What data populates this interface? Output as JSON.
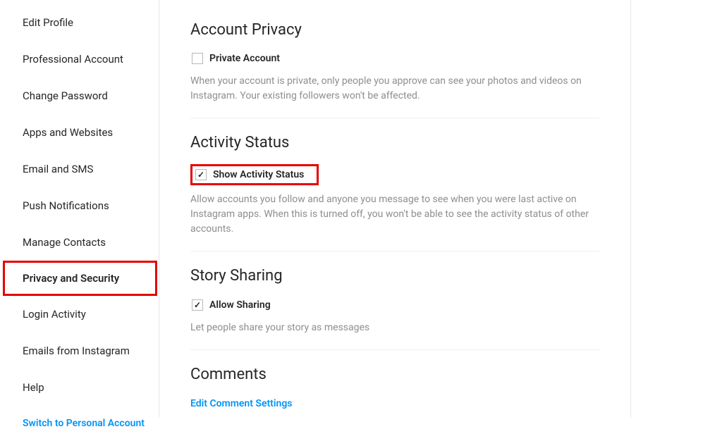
{
  "sidebar": {
    "items": [
      {
        "label": "Edit Profile"
      },
      {
        "label": "Professional Account"
      },
      {
        "label": "Change Password"
      },
      {
        "label": "Apps and Websites"
      },
      {
        "label": "Email and SMS"
      },
      {
        "label": "Push Notifications"
      },
      {
        "label": "Manage Contacts"
      },
      {
        "label": "Privacy and Security"
      },
      {
        "label": "Login Activity"
      },
      {
        "label": "Emails from Instagram"
      },
      {
        "label": "Help"
      }
    ],
    "switch_link": "Switch to Personal Account"
  },
  "sections": {
    "account_privacy": {
      "title": "Account Privacy",
      "checkbox_label": "Private Account",
      "description": "When your account is private, only people you approve can see your photos and videos on Instagram. Your existing followers won't be affected."
    },
    "activity_status": {
      "title": "Activity Status",
      "checkbox_label": "Show Activity Status",
      "description": "Allow accounts you follow and anyone you message to see when you were last active on Instagram apps. When this is turned off, you won't be able to see the activity status of other accounts."
    },
    "story_sharing": {
      "title": "Story Sharing",
      "checkbox_label": "Allow Sharing",
      "description": "Let people share your story as messages"
    },
    "comments": {
      "title": "Comments",
      "link": "Edit Comment Settings"
    }
  }
}
